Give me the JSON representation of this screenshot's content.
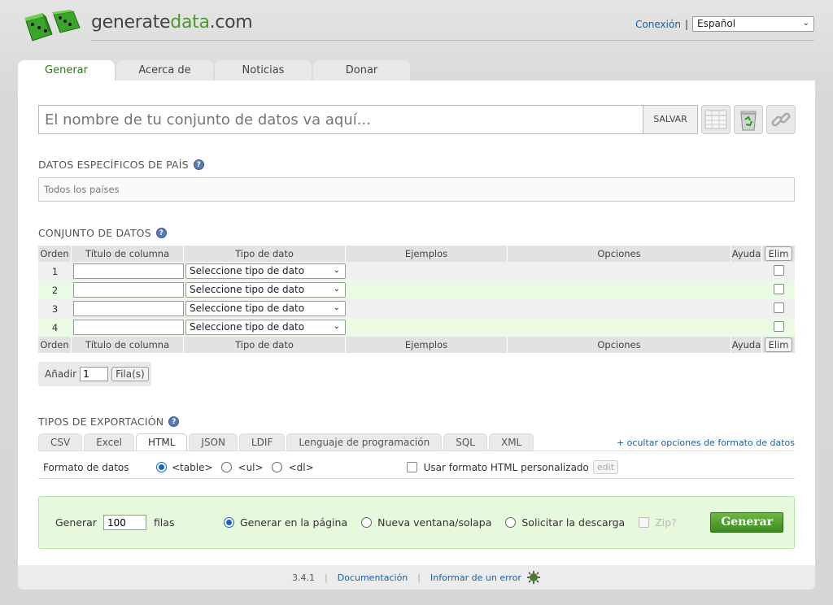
{
  "header": {
    "logo_text_a": "generate",
    "logo_text_b": "data",
    "logo_text_c": ".com",
    "login_label": "Conexión",
    "separator": "|",
    "language": "Español"
  },
  "tabs": [
    {
      "label": "Generar",
      "active": true
    },
    {
      "label": "Acerca de"
    },
    {
      "label": "Noticias"
    },
    {
      "label": "Donar"
    }
  ],
  "dataset": {
    "name_placeholder": "El nombre de tu conjunto de datos va aquí...",
    "save_label": "SALVAR"
  },
  "country": {
    "title": "DATOS ESPECÍFICOS DE PAÍS",
    "value": "Todos los países"
  },
  "grid": {
    "title": "CONJUNTO DE DATOS",
    "headers": {
      "order": "Orden",
      "title": "Título de columna",
      "type": "Tipo de dato",
      "examples": "Ejemplos",
      "options": "Opciones",
      "help": "Ayuda",
      "delete": "Elim"
    },
    "rows": [
      {
        "order": "1",
        "type": "Seleccione tipo de dato"
      },
      {
        "order": "2",
        "type": "Seleccione tipo de dato"
      },
      {
        "order": "3",
        "type": "Seleccione tipo de dato"
      },
      {
        "order": "4",
        "type": "Seleccione tipo de dato"
      }
    ],
    "add_label": "Añadir",
    "add_value": "1",
    "rows_button": "Fila(s)"
  },
  "export": {
    "title": "TIPOS DE EXPORTACIÓN",
    "tabs": [
      "CSV",
      "Excel",
      "HTML",
      "JSON",
      "LDIF",
      "Lenguaje de programación",
      "SQL",
      "XML"
    ],
    "active_tab": "HTML",
    "toggle_link": "+ ocultar opciones de formato de datos",
    "format_label": "Formato de datos",
    "formats": [
      "<table>",
      "<ul>",
      "<dl>"
    ],
    "custom_html_label": "Usar formato HTML personalizado",
    "edit_label": "edit"
  },
  "generate": {
    "label": "Generar",
    "rows_value": "100",
    "rows_label": "filas",
    "options": [
      "Generar en la página",
      "Nueva ventana/solapa",
      "Solicitar la descarga"
    ],
    "zip_label": "Zip?",
    "button": "Generar"
  },
  "footer": {
    "version": "3.4.1",
    "docs": "Documentación",
    "bug": "Informar de un error"
  },
  "colors": {
    "accent_green": "#4a9a2a",
    "link_blue": "#1d5fa0",
    "generate_bg": "#e6f9dd"
  }
}
